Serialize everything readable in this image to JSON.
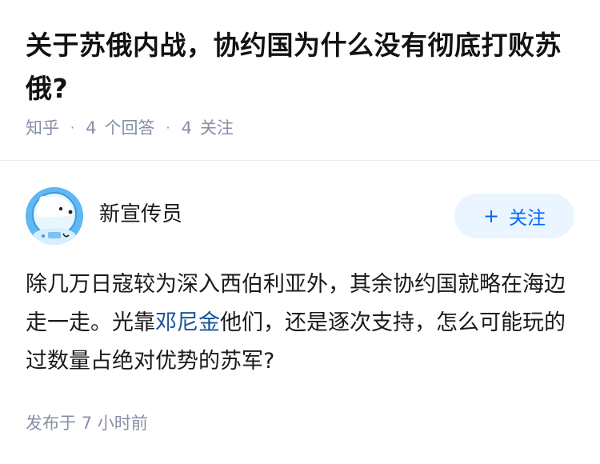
{
  "question": {
    "title": "关于苏俄内战，协约国为什么没有彻底打败苏俄?",
    "source": "知乎",
    "answer_count": "4",
    "answer_label": "个回答",
    "follower_count": "4",
    "follower_label": "关注"
  },
  "answer": {
    "author": {
      "name": "新宣传员",
      "avatar_icon": "polar-bear-astronaut-avatar",
      "avatar_bg": "#5fb8f2"
    },
    "follow_button": {
      "icon": "plus-icon",
      "label": "关注",
      "color": "#0066ff",
      "bg": "#ebf5ff"
    },
    "content": {
      "part1": "除几万日寇较为深入西伯利亚外，其余协约国就略在海边走一走。光靠",
      "mention": "邓尼金",
      "part2": "他们，还是逐次支持，怎么可能玩的过数量占绝对优势的苏军?"
    },
    "published_label": "发布于",
    "published_time": "7 小时前"
  },
  "colors": {
    "meta_gray": "#8590a6",
    "link_blue": "#175199"
  }
}
